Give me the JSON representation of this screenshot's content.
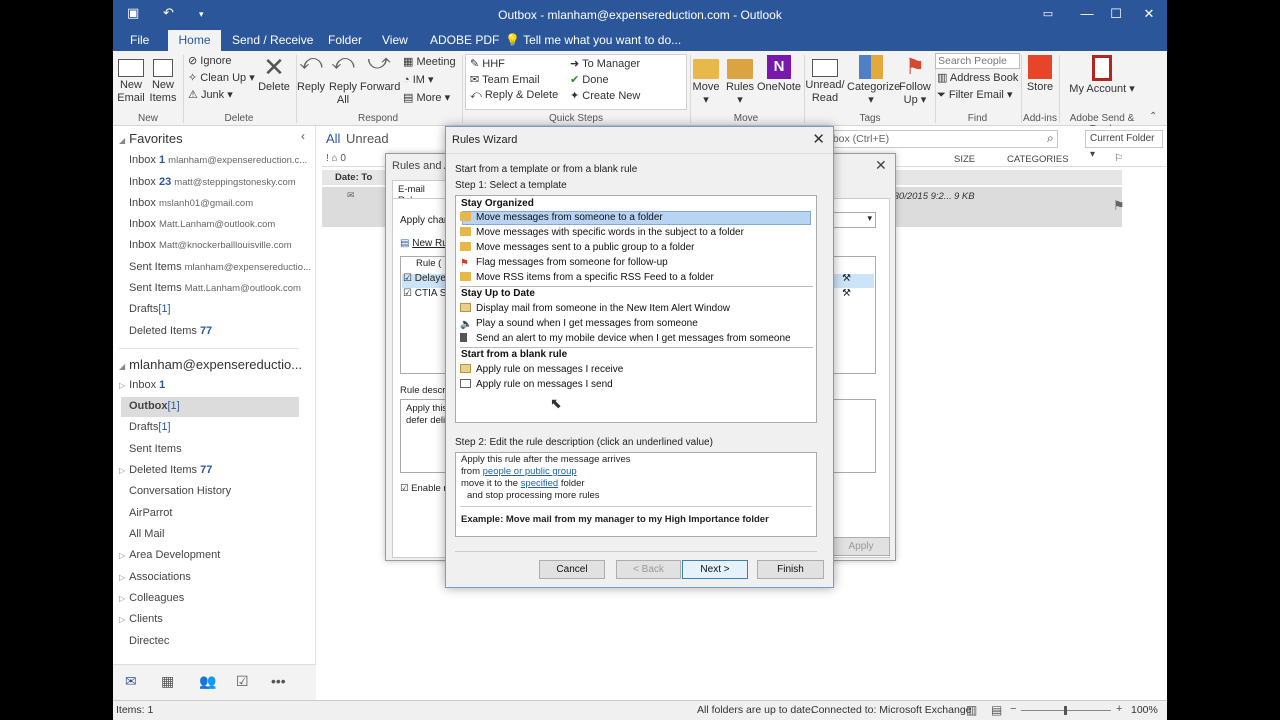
{
  "window": {
    "title": "Outbox - mlanham@expensereduction.com - Outlook"
  },
  "tabs": [
    "File",
    "Home",
    "Send / Receive",
    "Folder",
    "View",
    "ADOBE PDF"
  ],
  "tell_me": "Tell me what you want to do...",
  "ribbon": {
    "new_email": "New Email",
    "new_items": "New Items",
    "ignore": "Ignore",
    "clean_up": "Clean Up",
    "junk": "Junk",
    "delete": "Delete",
    "reply": "Reply",
    "reply_all": "Reply All",
    "forward": "Forward",
    "meeting": "Meeting",
    "im": "IM",
    "more": "More",
    "qs_hhf": "HHF",
    "qs_team_email": "Team Email",
    "qs_reply_delete": "Reply & Delete",
    "qs_to_manager": "To Manager",
    "qs_done": "Done",
    "qs_create_new": "Create New",
    "move": "Move",
    "rules": "Rules",
    "onenote": "OneNote",
    "unread_read": "Unread/ Read",
    "categorize": "Categorize",
    "follow_up": "Follow Up",
    "search_people": "Search People",
    "address_book": "Address Book",
    "filter_email": "Filter Email",
    "store": "Store",
    "my_account": "My Account",
    "groups": {
      "new": "New",
      "delete": "Delete",
      "respond": "Respond",
      "quick_steps": "Quick Steps",
      "move": "Move",
      "tags": "Tags",
      "find": "Find",
      "addins": "Add-ins",
      "adobe": "Adobe Send & Track"
    }
  },
  "nav": {
    "favorites": "Favorites",
    "fav_items": [
      {
        "label": "Inbox",
        "count": "1",
        "acct": "mlanham@expensereduction.c..."
      },
      {
        "label": "Inbox",
        "count": "23",
        "acct": "matt@steppingstonesky.com"
      },
      {
        "label": "Inbox",
        "count": "",
        "acct": "mslanh01@gmail.com"
      },
      {
        "label": "Inbox",
        "count": "",
        "acct": "Matt.Lanham@outlook.com"
      },
      {
        "label": "Inbox",
        "count": "",
        "acct": "Matt@knockerballlouisville.com"
      },
      {
        "label": "Sent Items",
        "count": "",
        "acct": "mlanham@expensereductio..."
      },
      {
        "label": "Sent Items",
        "count": "",
        "acct": "Matt.Lanham@outlook.com"
      },
      {
        "label": "Drafts",
        "count": "[1]",
        "acct": ""
      },
      {
        "label": "Deleted Items",
        "count": "77",
        "acct": ""
      }
    ],
    "account": "mlanham@expensereductio...",
    "folders": [
      {
        "label": "Inbox",
        "count": "1"
      },
      {
        "label": "Outbox",
        "count": "[1]"
      },
      {
        "label": "Drafts",
        "count": "[1]"
      },
      {
        "label": "Sent Items",
        "count": ""
      },
      {
        "label": "Deleted Items",
        "count": "77"
      },
      {
        "label": "Conversation History",
        "count": ""
      },
      {
        "label": "AirParrot",
        "count": ""
      },
      {
        "label": "All Mail",
        "count": ""
      },
      {
        "label": "Area Development",
        "count": ""
      },
      {
        "label": "Associations",
        "count": ""
      },
      {
        "label": "Colleagues",
        "count": ""
      },
      {
        "label": "Clients",
        "count": ""
      },
      {
        "label": "Directec",
        "count": ""
      }
    ]
  },
  "list": {
    "all": "All",
    "unread": "Unread",
    "search_placeholder": "nbox (Ctrl+E)",
    "current_folder": "Current Folder",
    "col_size": "SIZE",
    "col_categories": "CATEGORIES",
    "col_date": "Date: To",
    "row_date": "/30/2015 9:2...",
    "row_size": "9 KB"
  },
  "rules_alerts": {
    "title": "Rules and A",
    "tab": "E-mail Rules",
    "apply_changes": "Apply chan",
    "new_rule": "New Ru",
    "col_rule": "Rule (",
    "rows": [
      "Delaye",
      "CTIA S"
    ],
    "rule_desc": "Rule descri",
    "desc_line1": "Apply this",
    "desc_line2": "defer deli",
    "enable": "Enable r",
    "apply_btn": "Apply"
  },
  "wizard": {
    "title": "Rules Wizard",
    "intro": "Start from a template or from a blank rule",
    "step1": "Step 1: Select a template",
    "sections": [
      {
        "header": "Stay Organized",
        "items": [
          "Move messages from someone to a folder",
          "Move messages with specific words in the subject to a folder",
          "Move messages sent to a public group to a folder",
          "Flag messages from someone for follow-up",
          "Move RSS items from a specific RSS Feed to a folder"
        ]
      },
      {
        "header": "Stay Up to Date",
        "items": [
          "Display mail from someone in the New Item Alert Window",
          "Play a sound when I get messages from someone",
          "Send an alert to my mobile device when I get messages from someone"
        ]
      },
      {
        "header": "Start from a blank rule",
        "items": [
          "Apply rule on messages I receive",
          "Apply rule on messages I send"
        ]
      }
    ],
    "step2": "Step 2: Edit the rule description (click an underlined value)",
    "desc": {
      "line1": "Apply this rule after the message arrives",
      "from": "from",
      "people": "people or public group",
      "move_to": "move it to the",
      "specified": "specified",
      "folder": "folder",
      "stop": "and stop processing more rules",
      "example": "Example: Move mail from my manager to my High Importance folder"
    },
    "buttons": {
      "cancel": "Cancel",
      "back": "< Back",
      "next": "Next >",
      "finish": "Finish"
    }
  },
  "status": {
    "items": "Items: 1",
    "uptodate": "All folders are up to date.",
    "connected": "Connected to: Microsoft Exchange",
    "zoom": "100%"
  }
}
